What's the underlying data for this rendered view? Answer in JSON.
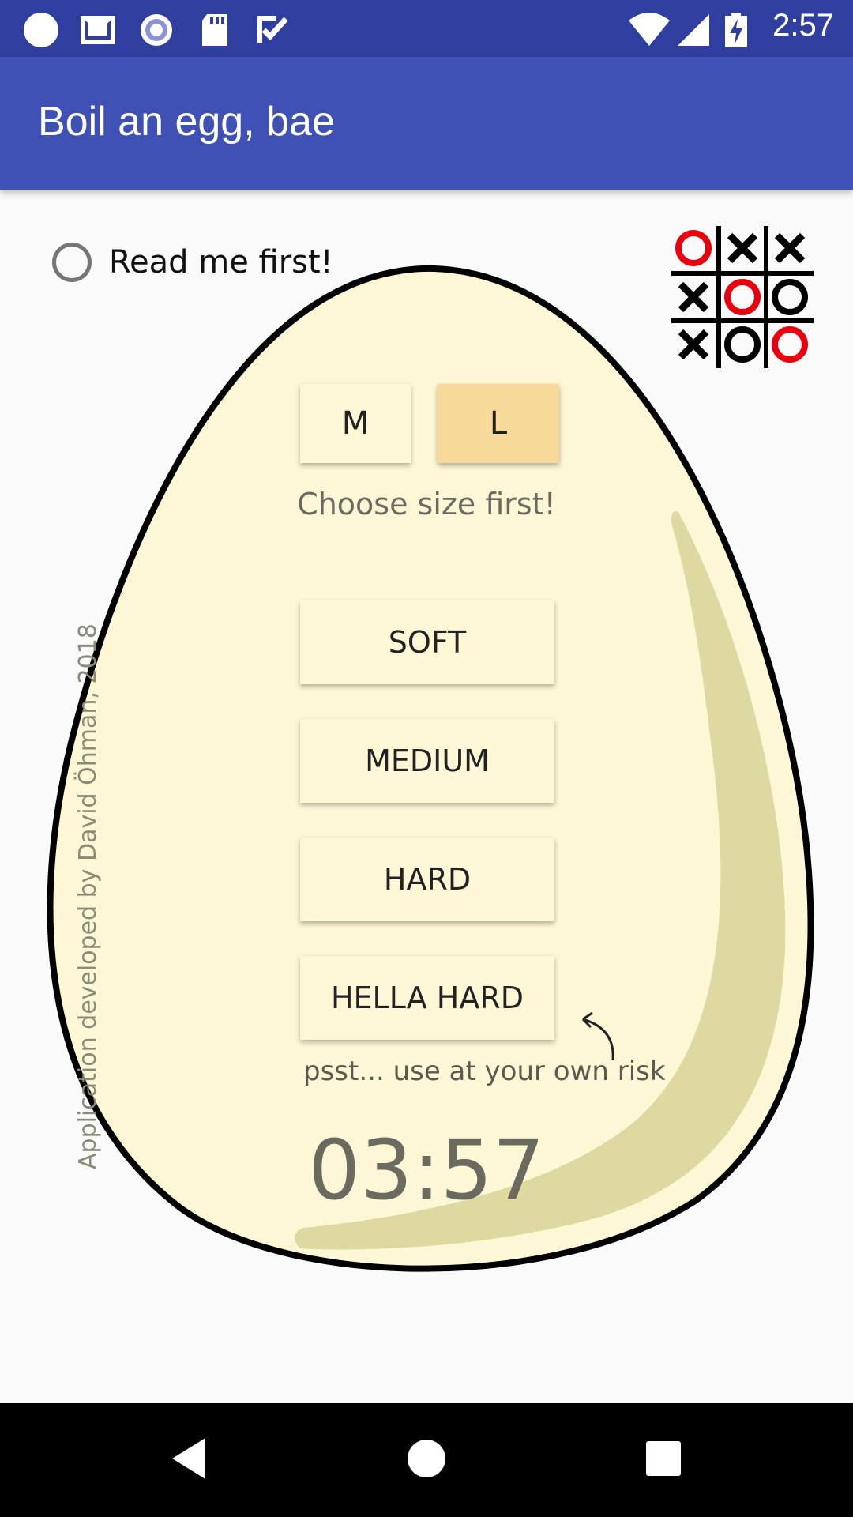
{
  "status_bar": {
    "time": "2:57",
    "icons": [
      "circle-icon",
      "mail-icon",
      "record-icon",
      "sd-card-icon",
      "checklist-icon",
      "wifi-icon",
      "signal-icon",
      "battery-charging-icon"
    ]
  },
  "app_bar": {
    "title": "Boil an egg, bae"
  },
  "read_me": {
    "label": "Read me first!"
  },
  "size": {
    "m_label": "M",
    "l_label": "L",
    "hint": "Choose size first!"
  },
  "boil_levels": {
    "soft": "SOFT",
    "medium": "MEDIUM",
    "hard": "HARD",
    "hella_hard": "HELLA HARD"
  },
  "warning": "psst... use at your own risk",
  "timer": "03:57",
  "credit": "Application developed by David Öhman, 2018",
  "colors": {
    "status_bar": "#303f9f",
    "app_bar": "#3f51b5",
    "egg_fill": "#fdf7d6",
    "egg_shade": "#ddd9a0",
    "selected_size": "#f7d99a",
    "ttt_o": "#e8000f"
  },
  "nav_bar": {
    "icons": [
      "back-icon",
      "home-icon",
      "recents-icon"
    ]
  }
}
